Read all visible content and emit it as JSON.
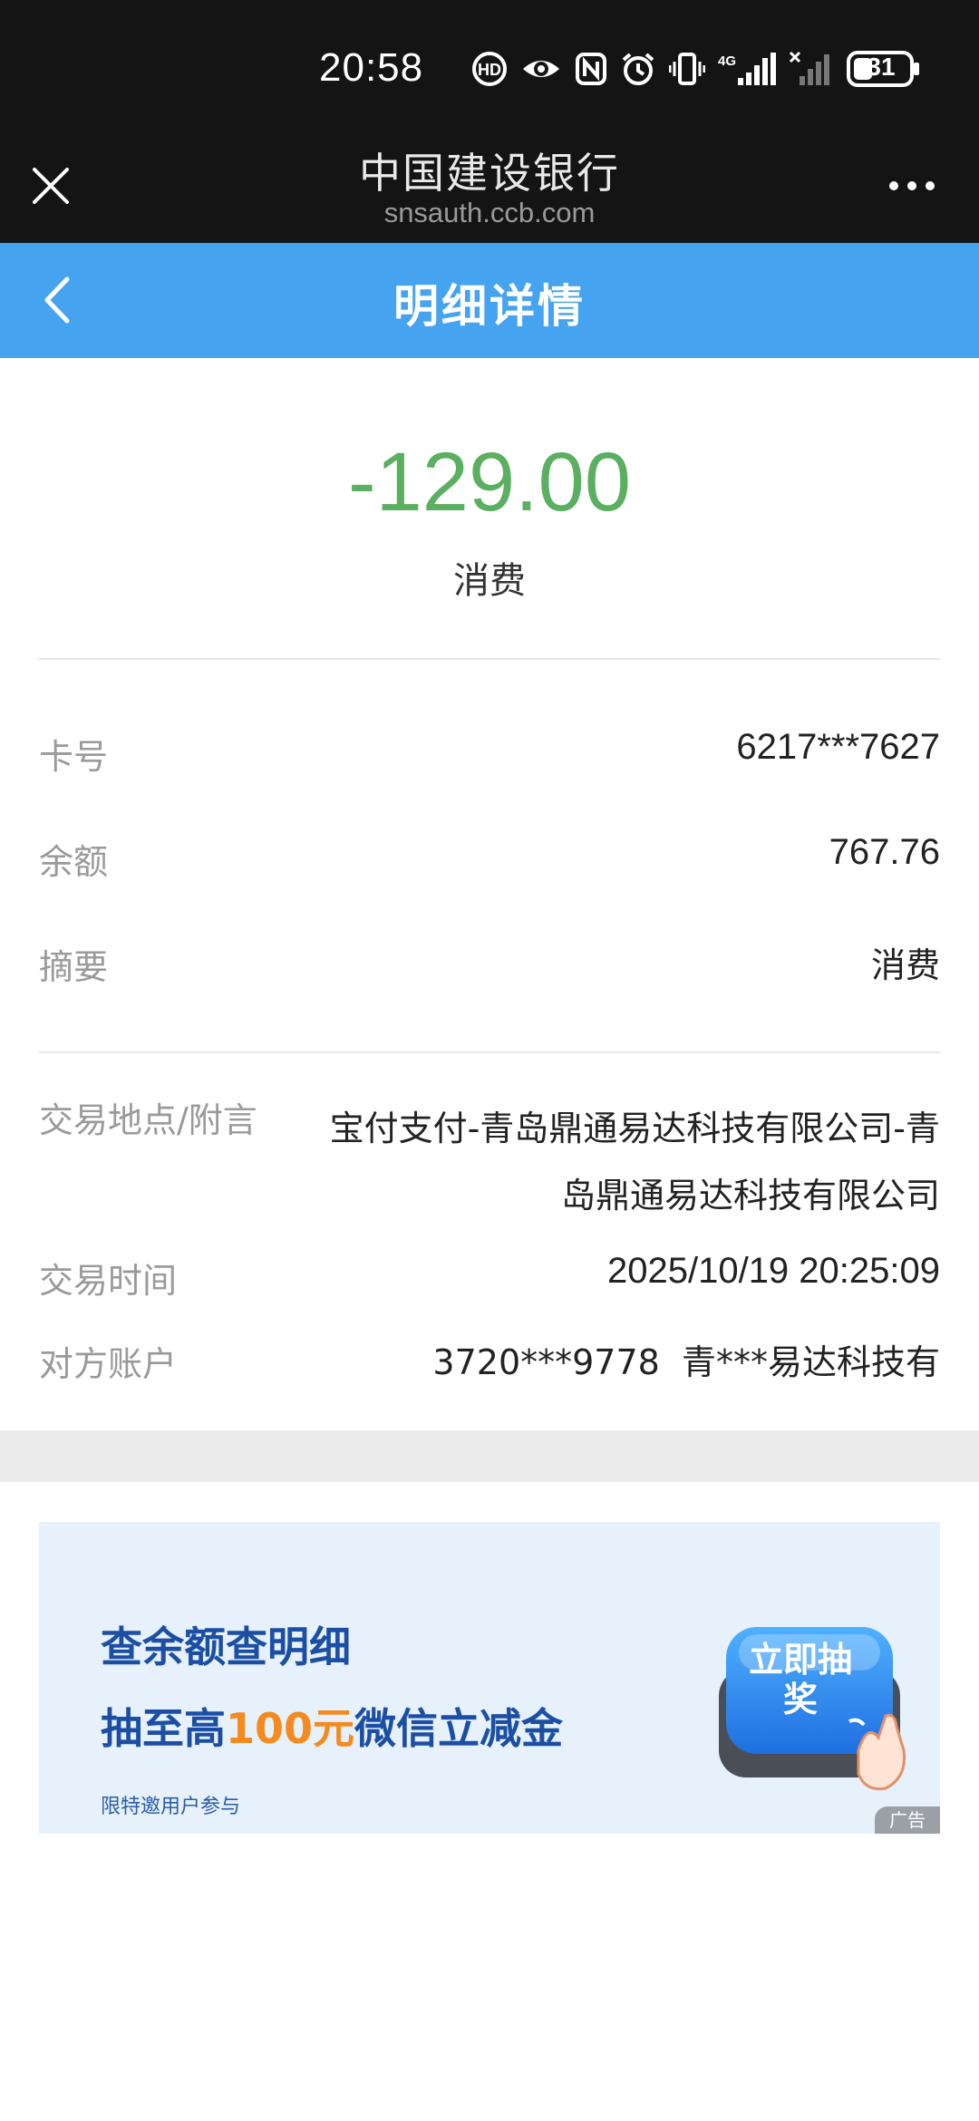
{
  "status_bar": {
    "time": "20:58",
    "battery": "31",
    "network": "4G"
  },
  "browser": {
    "site_title": "中国建设银行",
    "site_url": "snsauth.ccb.com"
  },
  "nav": {
    "title": "明细详情"
  },
  "transaction": {
    "amount": "-129.00",
    "type": "消费",
    "amount_color": "#5aaf61"
  },
  "details": [
    {
      "label": "卡号",
      "value": "6217***7627"
    },
    {
      "label": "余额",
      "value": "767.76"
    },
    {
      "label": "摘要",
      "value": "消费"
    }
  ],
  "extra": {
    "location_label": "交易地点/附言",
    "location_value_line1": "宝付支付-青岛鼎通易达科技有限公司-青",
    "location_value_line2": "岛鼎通易达科技有限公司",
    "time_label": "交易时间",
    "time_value": "2025/10/19 20:25:09",
    "counterparty_label": "对方账户",
    "counterparty_value": "3720***9778  青***易达科技有"
  },
  "ad": {
    "line1": "查余额查明细",
    "line2_prefix": "抽至高",
    "line2_highlight": "100元",
    "line2_suffix": "微信立减金",
    "note": "限特邀用户参与",
    "button": "立即抽奖",
    "tag": "广告"
  },
  "colors": {
    "nav_bg": "#46a3ef",
    "status_bg": "#141414",
    "ad_bg": "#e6f1fb",
    "ad_text": "#1c4fa4",
    "ad_highlight": "#f58a1f"
  }
}
